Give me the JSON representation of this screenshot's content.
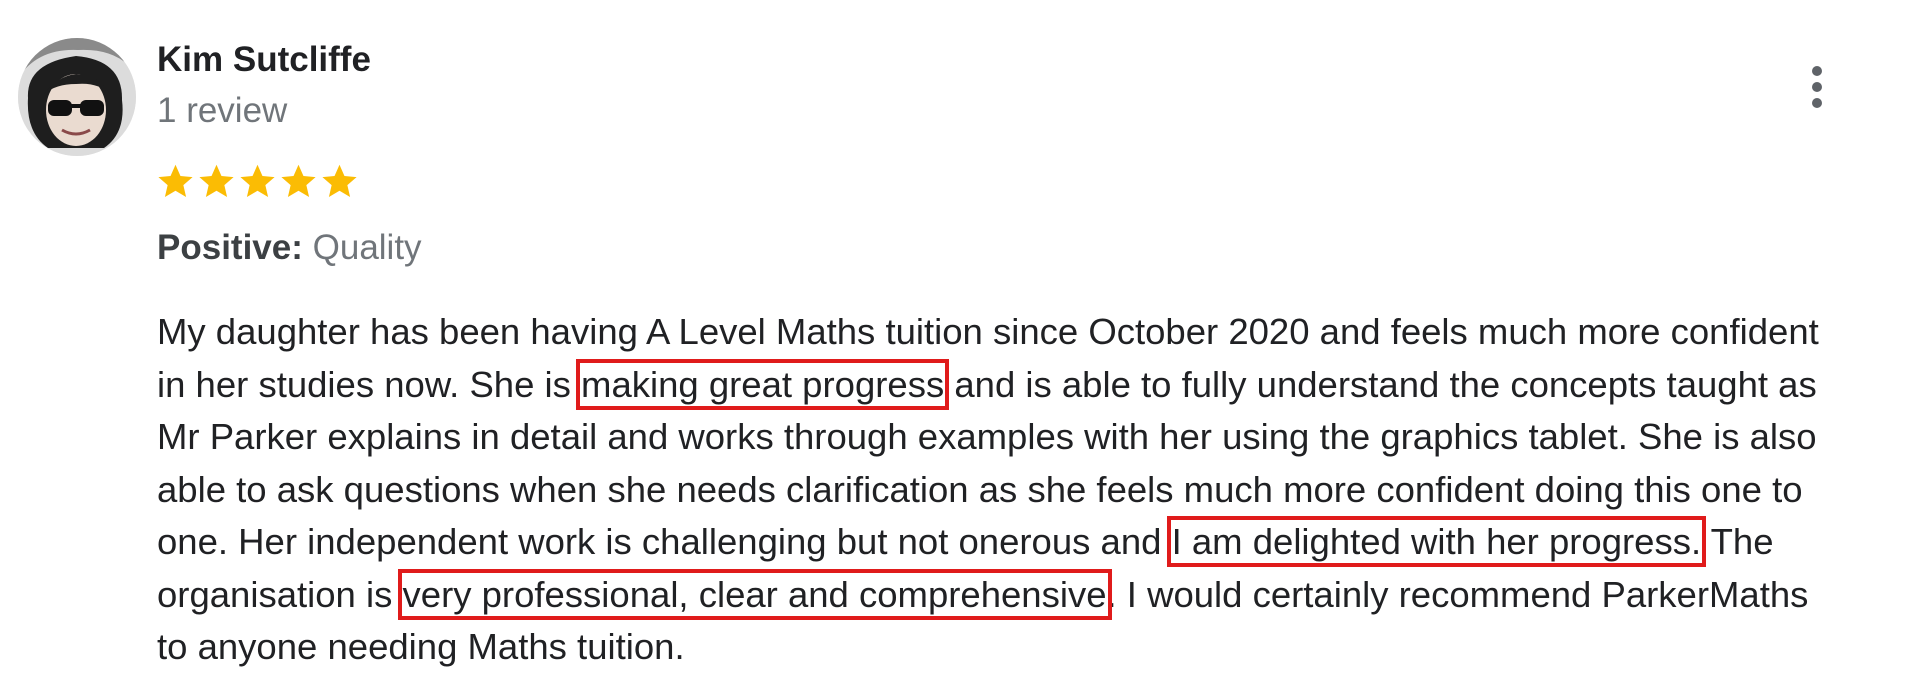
{
  "reviewer": {
    "name": "Kim Sutcliffe",
    "review_count": "1 review"
  },
  "rating": {
    "stars": 5,
    "max": 5,
    "star_color": "#fbbc04"
  },
  "attribute": {
    "label": "Positive:",
    "value": "Quality"
  },
  "review_lines": [
    [
      "My daughter has been having A Level Maths tuition since October 2020 and feels much more confident"
    ],
    [
      "in her studies now. She is ",
      "making great progress",
      " and is able to fully understand the concepts taught as"
    ],
    [
      "Mr Parker explains in detail and works through examples with her using the graphics tablet. She is also"
    ],
    [
      "able to ask questions when she needs clarification as she feels much more confident doing this one to"
    ],
    [
      "one. Her independent work is challenging but not onerous and ",
      "I am delighted with her progress.",
      " The"
    ],
    [
      "organisation is ",
      "very professional, clear and comprehensive",
      ". I would certainly recommend ParkerMaths"
    ],
    [
      "to anyone needing Maths tuition."
    ]
  ],
  "highlight_color": "#e01b1b"
}
